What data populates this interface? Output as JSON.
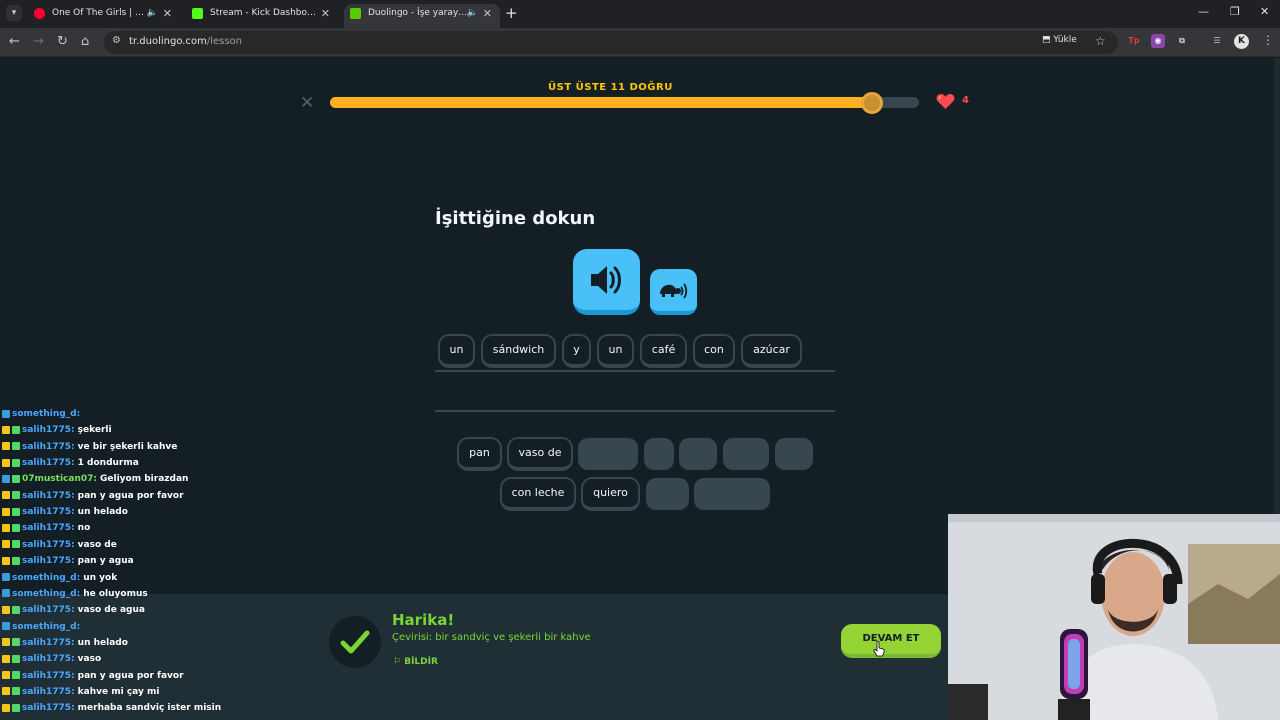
{
  "browser": {
    "tabs": [
      {
        "title": "One Of The Girls | YouTube",
        "favicon_color": "#ff0033",
        "active": false
      },
      {
        "title": "Stream - Kick Dashboard",
        "favicon_color": "#53fc18",
        "active": false
      },
      {
        "title": "Duolingo - İşe yarayan deneme",
        "favicon_color": "#58cc02",
        "active": true
      }
    ],
    "url_host": "tr.duolingo.com",
    "url_path": "/lesson",
    "install_label": "Yükle",
    "profile_initial": "K"
  },
  "lesson": {
    "streak_label": "ÜST ÜSTE 11 DOĞRU",
    "progress_fraction": 0.92,
    "hearts": "4",
    "prompt": "İşittiğine dokun",
    "answer_words": [
      "un",
      "sándwich",
      "y",
      "un",
      "café",
      "con",
      "azúcar"
    ],
    "word_bank_row1": [
      "pan",
      "vaso de"
    ],
    "word_bank_row2": [
      "con leche",
      "quiero"
    ],
    "colors": {
      "correct": "#79d634",
      "progress": "#ffb020",
      "audio": "#49c0f8",
      "heart": "#ff4b4b"
    }
  },
  "feedback": {
    "title": "Harika!",
    "translation": "Çevirisi: bir sandviç ve şekerli bir kahve",
    "report_label": "BİLDİR",
    "continue_label": "DEVAM ET"
  },
  "chat": [
    {
      "user": "something_d:",
      "msg": "",
      "badges": [
        "sub"
      ],
      "user_color": "blue"
    },
    {
      "user": "salih1775:",
      "msg": "şekerli",
      "badges": [
        "crown",
        "vip"
      ],
      "user_color": "blue"
    },
    {
      "user": "salih1775:",
      "msg": "ve bir şekerli kahve",
      "badges": [
        "crown",
        "vip"
      ],
      "user_color": "blue"
    },
    {
      "user": "salih1775:",
      "msg": "1 dondurma",
      "badges": [
        "crown",
        "vip"
      ],
      "user_color": "blue"
    },
    {
      "user": "07mustican07:",
      "msg": "Geliyom birazdan",
      "badges": [
        "mod",
        "vip"
      ],
      "user_color": "green"
    },
    {
      "user": "salih1775:",
      "msg": "pan y agua por favor",
      "badges": [
        "crown",
        "vip"
      ],
      "user_color": "blue"
    },
    {
      "user": "salih1775:",
      "msg": "un helado",
      "badges": [
        "crown",
        "vip"
      ],
      "user_color": "blue"
    },
    {
      "user": "salih1775:",
      "msg": "no",
      "badges": [
        "crown",
        "vip"
      ],
      "user_color": "blue"
    },
    {
      "user": "salih1775:",
      "msg": "vaso de",
      "badges": [
        "crown",
        "vip"
      ],
      "user_color": "blue"
    },
    {
      "user": "salih1775:",
      "msg": "pan y agua",
      "badges": [
        "crown",
        "vip"
      ],
      "user_color": "blue"
    },
    {
      "user": "something_d:",
      "msg": "un yok",
      "badges": [
        "sub"
      ],
      "user_color": "blue"
    },
    {
      "user": "something_d:",
      "msg": "he oluyomus",
      "badges": [
        "sub"
      ],
      "user_color": "blue"
    },
    {
      "user": "salih1775:",
      "msg": "vaso de agua",
      "badges": [
        "crown",
        "vip"
      ],
      "user_color": "blue"
    },
    {
      "user": "something_d:",
      "msg": "",
      "badges": [
        "sub"
      ],
      "user_color": "blue"
    },
    {
      "user": "salih1775:",
      "msg": "un helado",
      "badges": [
        "crown",
        "vip"
      ],
      "user_color": "blue"
    },
    {
      "user": "salih1775:",
      "msg": "vaso",
      "badges": [
        "crown",
        "vip"
      ],
      "user_color": "blue"
    },
    {
      "user": "salih1775:",
      "msg": "pan y agua por favor",
      "badges": [
        "crown",
        "vip"
      ],
      "user_color": "blue"
    },
    {
      "user": "salih1775:",
      "msg": "kahve mi çay mi",
      "badges": [
        "crown",
        "vip"
      ],
      "user_color": "blue"
    },
    {
      "user": "salih1775:",
      "msg": "merhaba sandviç ister misin",
      "badges": [
        "crown",
        "vip"
      ],
      "user_color": "blue"
    }
  ]
}
